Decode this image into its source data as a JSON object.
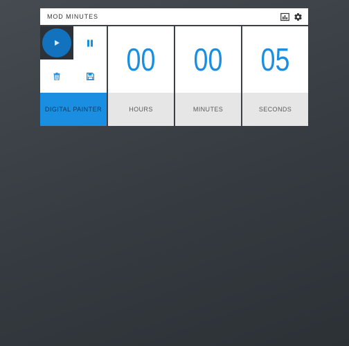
{
  "app": {
    "title": "MOD  MINUTES"
  },
  "toolbar": {
    "icons": [
      "bar-chart-icon",
      "gear-icon"
    ]
  },
  "controls": {
    "play_icon": "play-icon",
    "pause_icon": "pause-icon",
    "delete_icon": "trash-icon",
    "save_icon": "save-icon",
    "brand": "DIGITAL PAINTER"
  },
  "timer": {
    "units": [
      {
        "value": "00",
        "label": "HOURS"
      },
      {
        "value": "00",
        "label": "MINUTES"
      },
      {
        "value": "05",
        "label": "SECONDS"
      }
    ]
  },
  "colors": {
    "accent": "#1a8ee0",
    "play_button": "#1272bd",
    "background": "#353b40",
    "label_background": "#e6e6e6"
  }
}
